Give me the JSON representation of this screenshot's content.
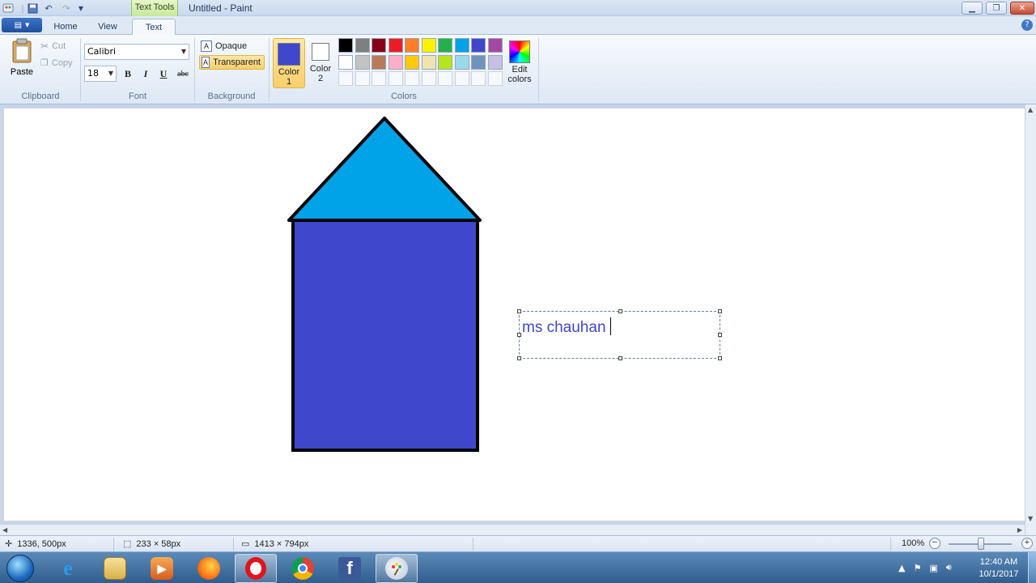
{
  "window": {
    "title": "Untitled - Paint",
    "contextual_tab": "Text Tools"
  },
  "tabs": [
    {
      "label": "Home"
    },
    {
      "label": "View"
    },
    {
      "label": "Text"
    }
  ],
  "ribbon": {
    "clipboard": {
      "paste": "Paste",
      "cut": "Cut",
      "copy": "Copy",
      "group": "Clipboard"
    },
    "font": {
      "name": "Calibri",
      "size": "18",
      "group": "Font",
      "bold": "B",
      "italic": "I",
      "underline": "U",
      "strike": "abc"
    },
    "background": {
      "opaque": "Opaque",
      "transparent": "Transparent",
      "group": "Background"
    },
    "colors": {
      "color1_label": "Color 1",
      "color2_label": "Color 2",
      "color1": "#3f48cc",
      "color2": "#ffffff",
      "group": "Colors",
      "edit_colors": "Edit colors",
      "palette": [
        "#000000",
        "#7f7f7f",
        "#880015",
        "#ed1c24",
        "#ff7f27",
        "#fff200",
        "#22b14c",
        "#00a2e8",
        "#3f48cc",
        "#a349a4",
        "#ffffff",
        "#c3c3c3",
        "#b97a57",
        "#ffaec9",
        "#ffc90e",
        "#efe4b0",
        "#b5e61d",
        "#99d9ea",
        "#7092be",
        "#c8bfe7"
      ]
    }
  },
  "canvas": {
    "text": "ms chauhan",
    "roof_color": "#00a2e8",
    "body_color": "#3f48cc"
  },
  "status": {
    "cursor_pos": "1336, 500px",
    "selection_size": "233 × 58px",
    "image_size": "1413 × 794px",
    "zoom": "100%"
  },
  "taskbar": {
    "time": "12:40 AM",
    "date": "10/1/2017"
  }
}
